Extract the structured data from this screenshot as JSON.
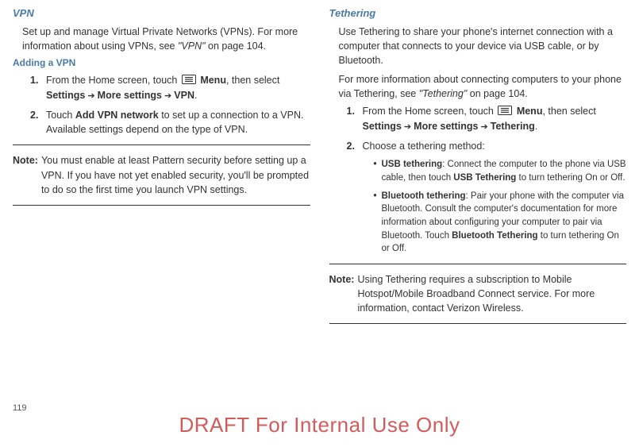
{
  "left": {
    "title": "VPN",
    "intro_parts": {
      "t1": "Set up and manage Virtual Private Networks (VPNs). For more information about using VPNs, see ",
      "ref": "\"VPN\"",
      "t2": " on page 104."
    },
    "subheading": "Adding a VPN",
    "steps": [
      {
        "num": "1.",
        "pre": "From the Home screen, touch ",
        "menu": "Menu",
        "post1": ", then select ",
        "b1": "Settings",
        "arr1": " ➔ ",
        "b2": "More settings",
        "arr2": "  ➔ ",
        "b3": "VPN",
        "end": "."
      },
      {
        "num": "2.",
        "pre": "Touch ",
        "b1": "Add VPN network",
        "post": " to set up a connection to a VPN. Available settings depend on the type of VPN."
      }
    ],
    "note": {
      "label": "Note:",
      "body": "You must enable at least Pattern security before setting up a VPN. If you have not yet enabled security, you'll be prompted to do so the first time you launch VPN settings."
    }
  },
  "right": {
    "title": "Tethering",
    "intro1": "Use Tethering to share your phone's internet connection with a computer that connects to your device via USB cable, or by Bluetooth.",
    "intro2_parts": {
      "t1": "For more information about connecting computers to your phone via Tethering, see ",
      "ref": "\"Tethering\"",
      "t2": " on page 104."
    },
    "steps": [
      {
        "num": "1.",
        "pre": "From the Home screen, touch ",
        "menu": "Menu",
        "post1": ", then select ",
        "b1": "Settings",
        "arr1": " ➔ ",
        "b2": "More settings",
        "arr2": " ➔ ",
        "b3": "Tethering",
        "end": "."
      },
      {
        "num": "2.",
        "text": "Choose a tethering method:"
      }
    ],
    "bullets": [
      {
        "b": "USB tethering",
        "t1": ": Connect the computer to the phone via USB cable, then touch ",
        "b2": "USB Tethering",
        "t2": " to turn tethering On or Off."
      },
      {
        "b": "Bluetooth tethering",
        "t1": ": Pair your phone with the computer via Bluetooth. Consult the computer's documentation for more information about configuring your computer to pair via Bluetooth. Touch ",
        "b2": "Bluetooth Tethering",
        "t2": " to turn tethering On or Off."
      }
    ],
    "note": {
      "label": "Note:",
      "body": "Using Tethering requires a subscription to Mobile Hotspot/Mobile Broadband Connect service. For more information, contact Verizon Wireless."
    }
  },
  "page_num": "119",
  "watermark": "DRAFT For Internal Use Only"
}
